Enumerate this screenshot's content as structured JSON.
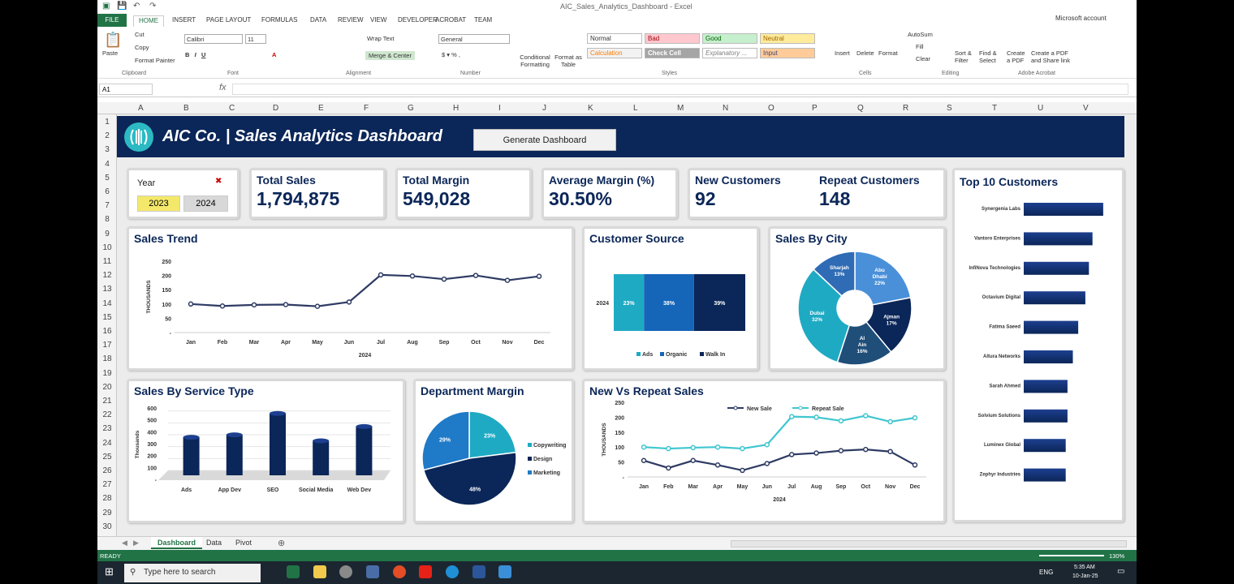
{
  "window": {
    "title": "AIC_Sales_Analytics_Dashboard - Excel",
    "account": "Microsoft account"
  },
  "ribbon": {
    "tabs": [
      "FILE",
      "HOME",
      "INSERT",
      "PAGE LAYOUT",
      "FORMULAS",
      "DATA",
      "REVIEW",
      "VIEW",
      "DEVELOPER",
      "ACROBAT",
      "TEAM"
    ],
    "clipboard": {
      "paste": "Paste",
      "cut": "Cut",
      "copy": "Copy",
      "format_painter": "Format Painter",
      "label": "Clipboard"
    },
    "font": {
      "name": "Calibri",
      "size": "11",
      "label": "Font"
    },
    "alignment": {
      "wrap": "Wrap Text",
      "merge": "Merge & Center",
      "label": "Alignment"
    },
    "number": {
      "format": "General",
      "label": "Number"
    },
    "styles": {
      "conditional": "Conditional Formatting",
      "format_table": "Format as Table",
      "normal": "Normal",
      "bad": "Bad",
      "good": "Good",
      "neutral": "Neutral",
      "calculation": "Calculation",
      "check_cell": "Check Cell",
      "explanatory": "Explanatory ...",
      "input": "Input",
      "label": "Styles"
    },
    "cells": {
      "insert": "Insert",
      "delete": "Delete",
      "format": "Format",
      "label": "Cells"
    },
    "editing": {
      "autosum": "AutoSum",
      "fill": "Fill",
      "clear": "Clear",
      "sort": "Sort & Filter",
      "find": "Find & Select",
      "label": "Editing"
    },
    "acrobat": {
      "create_pdf": "Create a PDF",
      "create_share": "Create a PDF and Share link",
      "label": "Adobe Acrobat"
    }
  },
  "formula_bar": {
    "name_box": "A1",
    "fx": "fx",
    "value": ""
  },
  "columns": [
    "A",
    "B",
    "C",
    "D",
    "E",
    "F",
    "G",
    "H",
    "I",
    "J",
    "K",
    "L",
    "M",
    "N",
    "O",
    "P",
    "Q",
    "R",
    "S",
    "T",
    "U",
    "V"
  ],
  "rows": [
    "1",
    "2",
    "3",
    "4",
    "5",
    "6",
    "7",
    "8",
    "9",
    "10",
    "11",
    "12",
    "13",
    "14",
    "15",
    "16",
    "17",
    "18",
    "19",
    "20",
    "21",
    "22",
    "23",
    "24",
    "25",
    "26",
    "27",
    "28",
    "29",
    "30"
  ],
  "dashboard": {
    "title": "AIC Co. | Sales Analytics Dashboard",
    "generate_button": "Generate Dashboard",
    "year": {
      "label": "Year",
      "options": [
        "2023",
        "2024"
      ]
    },
    "kpis": {
      "total_sales_label": "Total Sales",
      "total_sales": "1,794,875",
      "total_margin_label": "Total Margin",
      "total_margin": "549,028",
      "avg_margin_label": "Average Margin (%)",
      "avg_margin": "30.50%",
      "new_customers_label": "New Customers",
      "new_customers": "92",
      "repeat_customers_label": "Repeat Customers",
      "repeat_customers": "148"
    },
    "titles": {
      "sales_trend": "Sales Trend",
      "customer_source": "Customer Source",
      "sales_by_city": "Sales By City",
      "top10": "Top 10 Customers",
      "service_type": "Sales By Service Type",
      "dept_margin": "Department Margin",
      "new_vs_repeat": "New Vs Repeat Sales"
    }
  },
  "chart_data": [
    {
      "id": "sales_trend",
      "type": "line",
      "title": "Sales Trend",
      "ylabel": "THOUSANDS",
      "xlabel": "2024",
      "categories": [
        "Jan",
        "Feb",
        "Mar",
        "Apr",
        "May",
        "Jun",
        "Jul",
        "Aug",
        "Sep",
        "Oct",
        "Nov",
        "Dec"
      ],
      "values": [
        100,
        93,
        97,
        98,
        92,
        107,
        202,
        198,
        187,
        200,
        183,
        197
      ],
      "ylim": [
        0,
        250
      ],
      "yticks": [
        "-",
        "50",
        "100",
        "150",
        "200",
        "250"
      ],
      "color": "#2e3b63"
    },
    {
      "id": "customer_source",
      "type": "bar",
      "stacked": true,
      "orientation": "horizontal",
      "title": "Customer Source",
      "categories": [
        "2024"
      ],
      "series": [
        {
          "name": "Ads",
          "values": [
            23
          ],
          "label": "23%",
          "color": "#1faac4"
        },
        {
          "name": "Organic",
          "values": [
            38
          ],
          "label": "38%",
          "color": "#1565b8"
        },
        {
          "name": "Walk In",
          "values": [
            39
          ],
          "label": "39%",
          "color": "#0b2658"
        }
      ]
    },
    {
      "id": "sales_by_city",
      "type": "pie",
      "donut": true,
      "title": "Sales By City",
      "labels": [
        "Abu Dhabi",
        "Ajman",
        "Al Ain",
        "Dubai",
        "Sharjah"
      ],
      "values": [
        22,
        17,
        16,
        32,
        13
      ],
      "texts": [
        "Abu Dhabi 22%",
        "Ajman 17%",
        "Al Ain 16%",
        "Dubai 32%",
        "Sharjah 13%"
      ],
      "colors": [
        "#4a90d9",
        "#0b2658",
        "#1f4e79",
        "#1faac4",
        "#2f6cb5"
      ]
    },
    {
      "id": "top10",
      "type": "bar",
      "orientation": "horizontal",
      "title": "Top 10 Customers",
      "categories": [
        "Synergenia Labs",
        "Vantoro Enterprises",
        "InfiNova Technologies",
        "Octavium Digital",
        "Fatima Saeed",
        "Altura Networks",
        "Sarah Ahmed",
        "Solvium Solutions",
        "Luminex Global",
        "Zephyr Industries"
      ],
      "values": [
        89,
        77,
        73,
        69,
        61,
        55,
        49,
        49,
        47,
        47
      ]
    },
    {
      "id": "service_type",
      "type": "bar",
      "title": "Sales By Service Type",
      "ylabel": "Thousands",
      "categories": [
        "Ads",
        "App Dev",
        "SEO",
        "Social Media",
        "Web Dev"
      ],
      "values": [
        320,
        340,
        520,
        290,
        410
      ],
      "ylim": [
        0,
        600
      ],
      "yticks": [
        "-",
        "100",
        "200",
        "300",
        "400",
        "500",
        "600"
      ]
    },
    {
      "id": "dept_margin",
      "type": "pie",
      "title": "Department Margin",
      "labels": [
        "Copywriting",
        "Design",
        "Marketing"
      ],
      "values": [
        23,
        48,
        29
      ],
      "texts": [
        "23%",
        "48%",
        "29%"
      ],
      "colors": [
        "#1faac4",
        "#0b2658",
        "#1f7ac7"
      ]
    },
    {
      "id": "new_vs_repeat",
      "type": "line",
      "title": "New Vs Repeat Sales",
      "ylabel": "THOUSANDS",
      "xlabel": "2024",
      "categories": [
        "Jan",
        "Feb",
        "Mar",
        "Apr",
        "May",
        "Jun",
        "Jul",
        "Aug",
        "Sep",
        "Oct",
        "Nov",
        "Dec"
      ],
      "yticks": [
        "-",
        "50",
        "100",
        "150",
        "200",
        "250"
      ],
      "ylim": [
        0,
        250
      ],
      "series": [
        {
          "name": "New Sale",
          "values": [
            55,
            30,
            55,
            40,
            22,
            45,
            75,
            80,
            88,
            92,
            85,
            40
          ],
          "color": "#2e3b63"
        },
        {
          "name": "Repeat Sale",
          "values": [
            100,
            95,
            98,
            100,
            95,
            108,
            202,
            200,
            188,
            205,
            185,
            198
          ],
          "color": "#3fc6d0"
        }
      ]
    }
  ],
  "sheet_tabs": [
    "Dashboard",
    "Data",
    "Pivot"
  ],
  "status": {
    "ready": "READY",
    "zoom": "130%"
  },
  "taskbar": {
    "search": "Type here to search",
    "lang": "ENG",
    "time": "5:35 AM",
    "date": "10-Jan-25"
  }
}
